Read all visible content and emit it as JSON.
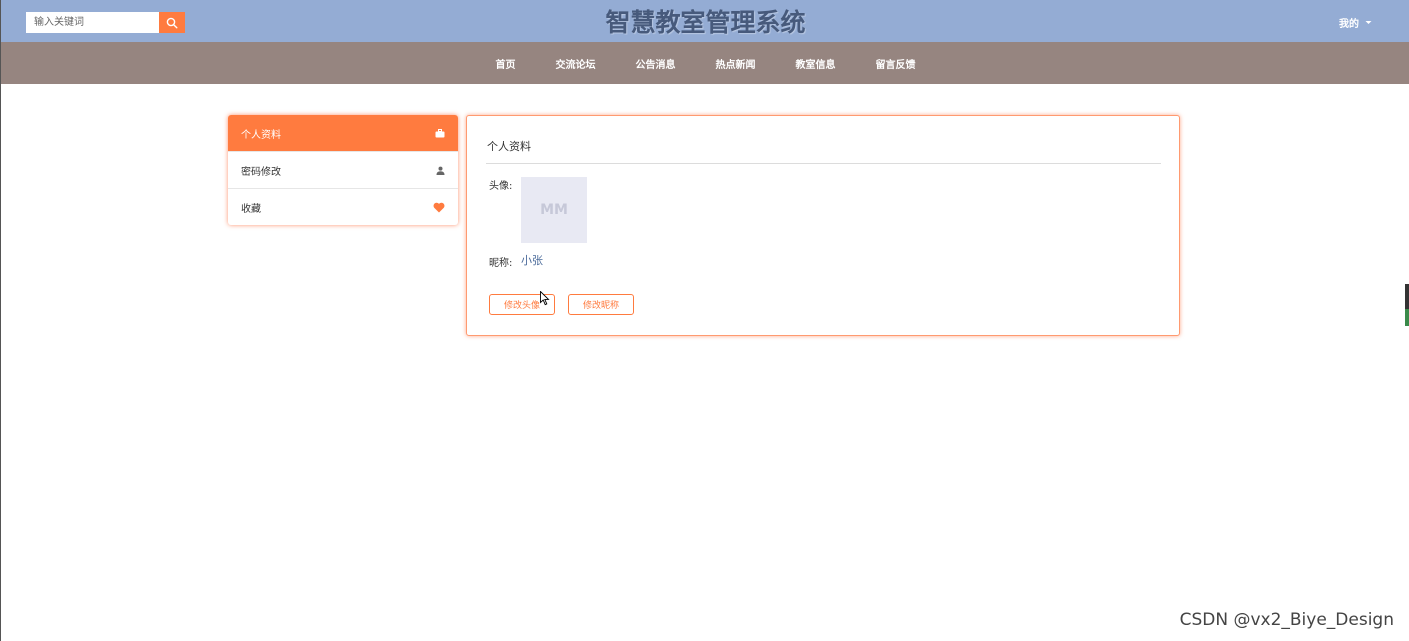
{
  "header": {
    "search_placeholder": "输入关键词",
    "search_icon": "search-icon",
    "site_title": "智慧教室管理系统",
    "user_menu_label": "我的",
    "user_menu_icon": "caret-down-icon",
    "colors": {
      "topbar": "#94acd4",
      "accent": "#ff7b3f",
      "title": "#475a7c"
    }
  },
  "nav": {
    "background": "#968580",
    "items": [
      {
        "label": "首页"
      },
      {
        "label": "交流论坛"
      },
      {
        "label": "公告消息"
      },
      {
        "label": "热点新闻"
      },
      {
        "label": "教室信息"
      },
      {
        "label": "留言反馈"
      }
    ]
  },
  "sidebar": {
    "items": [
      {
        "label": "个人资料",
        "icon": "briefcase-icon",
        "active": true
      },
      {
        "label": "密码修改",
        "icon": "user-icon",
        "active": false
      },
      {
        "label": "收藏",
        "icon": "heart-icon",
        "active": false
      }
    ]
  },
  "profile": {
    "title": "个人资料",
    "avatar_label": "头像:",
    "avatar_placeholder": "MM",
    "nickname_label": "昵称:",
    "nickname_value": "小张",
    "buttons": {
      "change_avatar": "修改头像",
      "change_nickname": "修改昵称"
    }
  },
  "watermark": "CSDN @vx2_Biye_Design"
}
